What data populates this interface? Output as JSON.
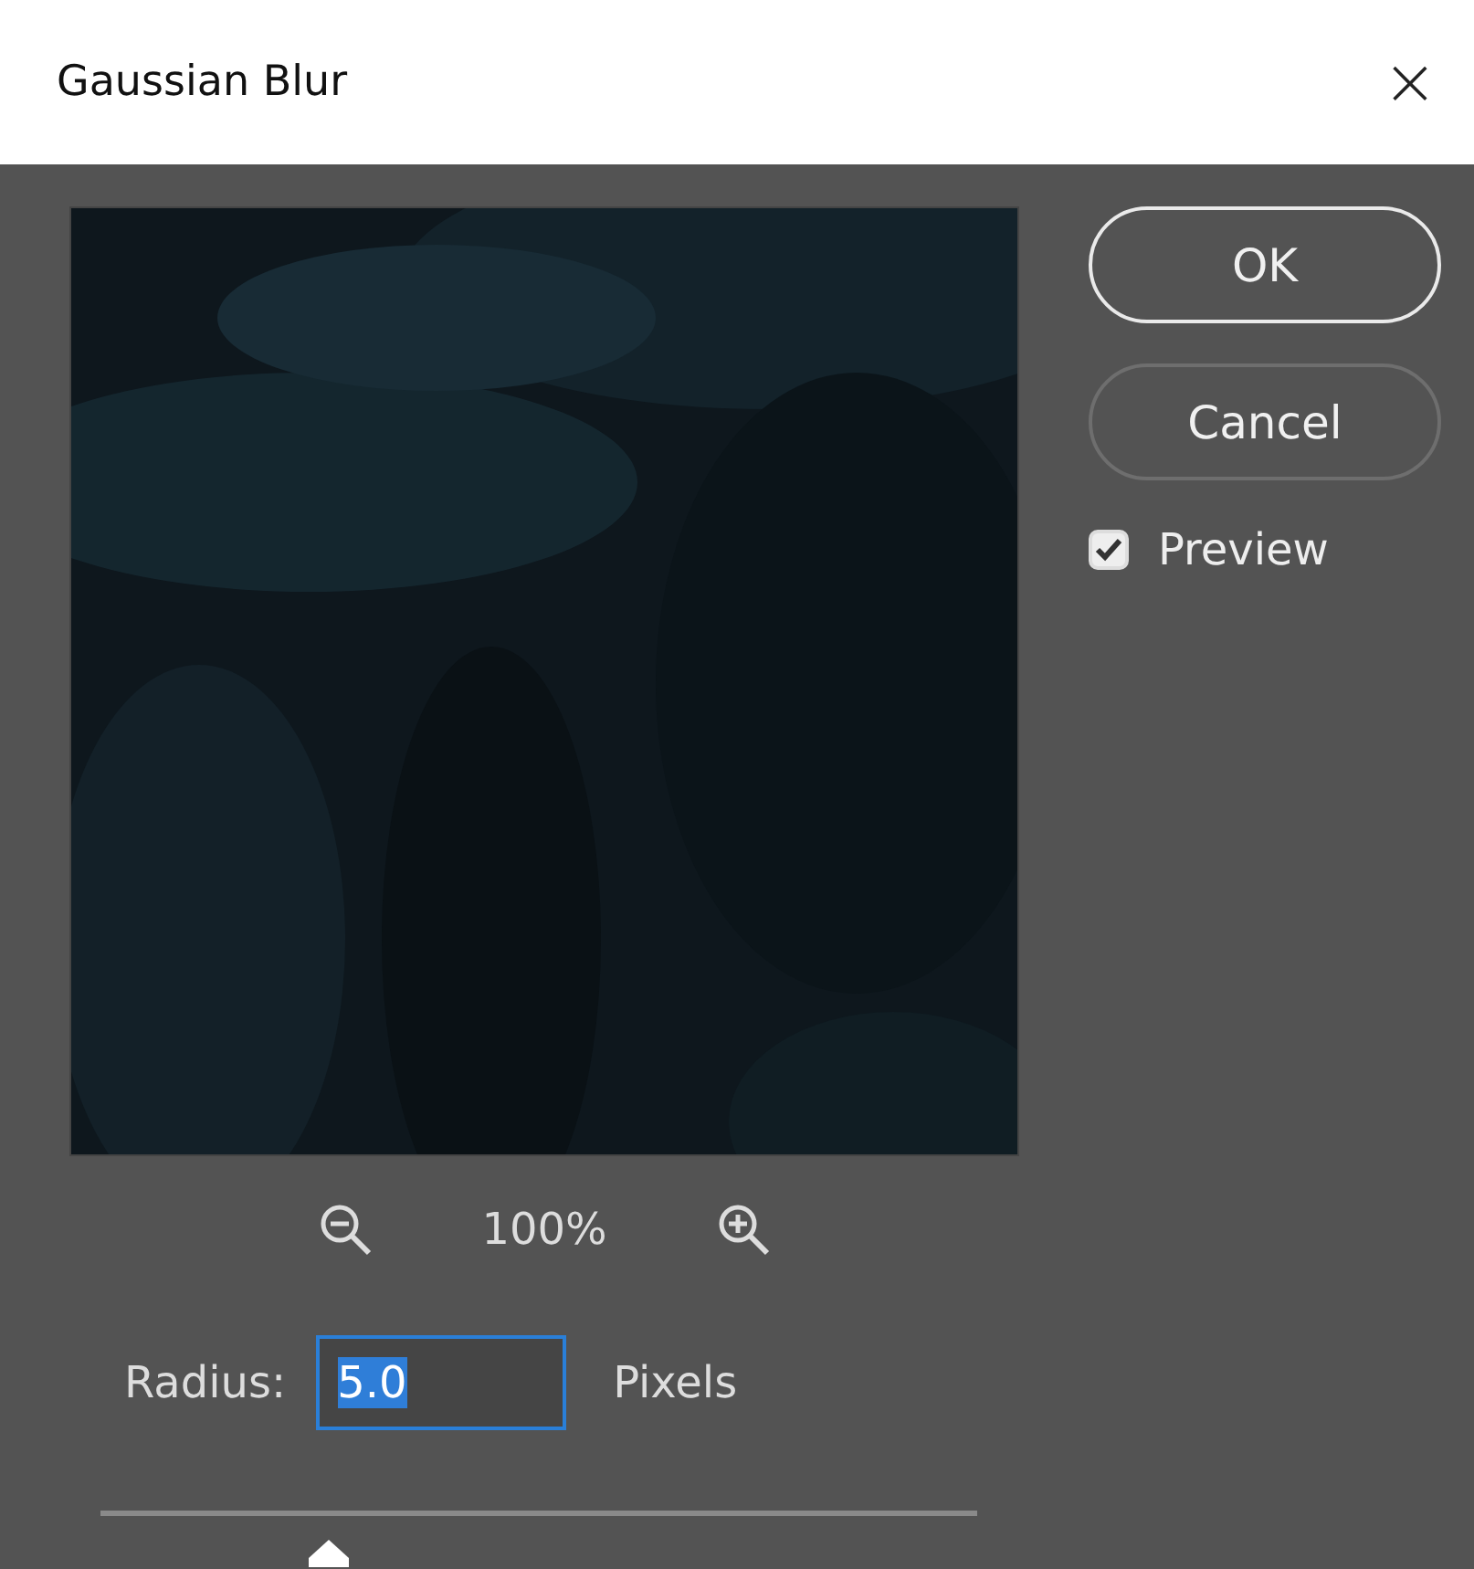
{
  "window": {
    "title": "Gaussian Blur",
    "close": "×"
  },
  "buttons": [
    {
      "label": "OK",
      "default": true
    },
    {
      "label": "Cancel",
      "default": false
    }
  ],
  "preview_checkbox": {
    "label": "Preview",
    "checked": true
  },
  "zoom": {
    "level_text": "100%"
  },
  "radius": {
    "label": "Radius:",
    "value": "5.0",
    "text_selected": true,
    "unit": "Pixels"
  },
  "slider": {
    "level": 0.26
  }
}
